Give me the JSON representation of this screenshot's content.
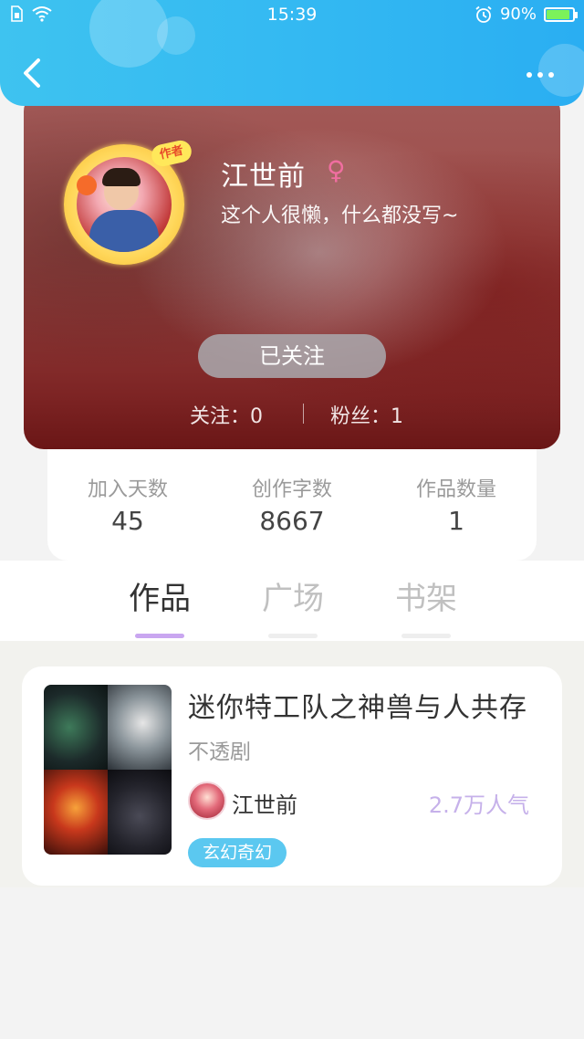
{
  "status_bar": {
    "time": "15:39",
    "battery": "90%",
    "battery_level": 0.9
  },
  "profile": {
    "username": "江世前",
    "gender_symbol": "♀",
    "bio": "这个人很懒，什么都没写~",
    "avatar_badge": "作者",
    "follow_button_label": "已关注",
    "following_label": "关注：0",
    "fans_label": "粉丝：1"
  },
  "stats": [
    {
      "label": "加入天数",
      "value": "45"
    },
    {
      "label": "创作字数",
      "value": "8667"
    },
    {
      "label": "作品数量",
      "value": "1"
    }
  ],
  "tabs": [
    {
      "label": "作品",
      "active": true
    },
    {
      "label": "广场",
      "active": false
    },
    {
      "label": "书架",
      "active": false
    }
  ],
  "works": [
    {
      "title": "迷你特工队之神兽与人共存",
      "subtitle": "不透剧",
      "author": "江世前",
      "popularity": "2.7万人气",
      "genre": "玄幻奇幻"
    }
  ],
  "colors": {
    "header_gradient_start": "#3ec3f0",
    "header_gradient_end": "#2aaef2",
    "active_tab_underline": "#c9a6f0",
    "popularity_text": "#c6b1ea",
    "genre_tag": "#5bc8f0",
    "gender_symbol": "#f06ea0"
  },
  "icons": {
    "back": "chevron-left-icon",
    "more": "more-dots-icon",
    "wifi": "wifi-icon",
    "alarm": "alarm-icon",
    "battery": "battery-icon",
    "sim": "sim-card-icon"
  }
}
